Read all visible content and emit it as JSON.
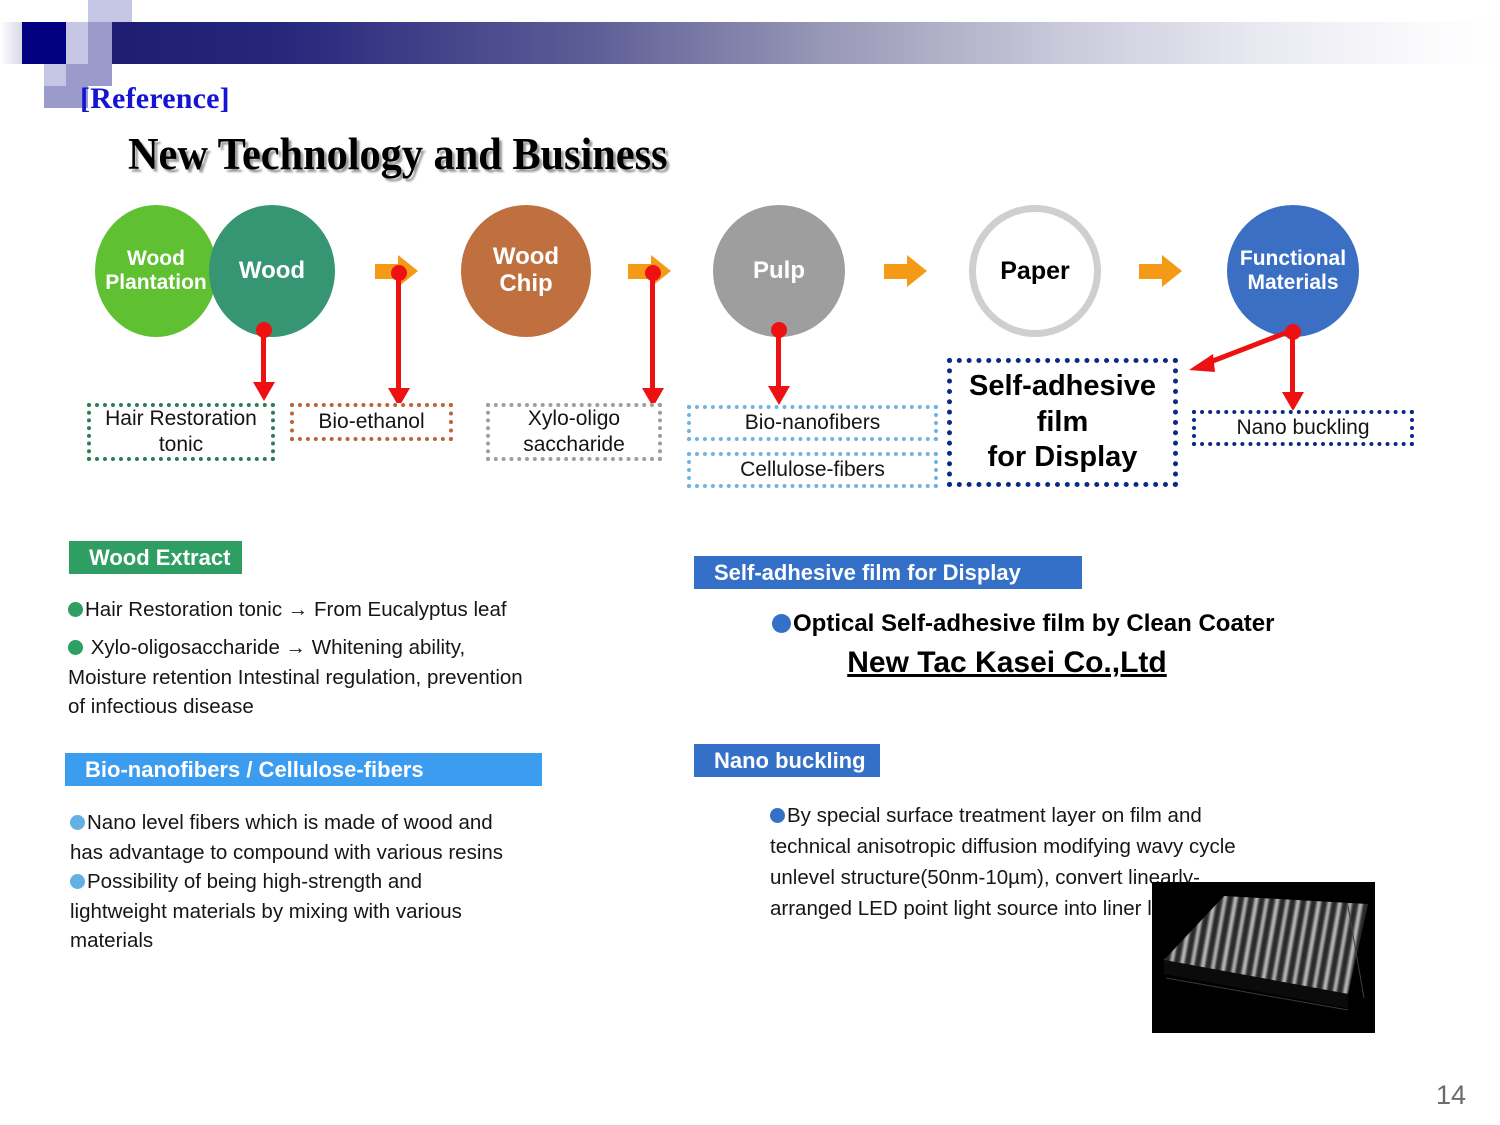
{
  "header": {
    "reference_label": "[Reference]",
    "title": "New Technology and Business"
  },
  "flow": {
    "nodes": [
      {
        "label": "Wood\nPlantation",
        "color": "#5fc132",
        "name": "wood-plantation"
      },
      {
        "label": "Wood",
        "color": "#369673",
        "name": "wood"
      },
      {
        "label": "Wood\nChip",
        "color": "#c0703f",
        "name": "wood-chip"
      },
      {
        "label": "Pulp",
        "color": "#9e9e9e",
        "name": "pulp"
      },
      {
        "label": "Paper",
        "color": "#ffffff",
        "name": "paper"
      },
      {
        "label": "Functional\nMaterials",
        "color": "#3b6fc4",
        "name": "functional-materials"
      }
    ],
    "arrow_icon": "right-arrow-icon",
    "boxes": [
      {
        "label": "Hair Restoration\ntonic",
        "name": "hair-restoration-tonic",
        "border": "#2f7d54"
      },
      {
        "label": "Bio-ethanol",
        "name": "bio-ethanol",
        "border": "#b9653a"
      },
      {
        "label": "Xylo-oligo\nsaccharide",
        "name": "xylo-oligo-saccharide",
        "border": "#9e9e9e"
      },
      {
        "label": "Bio-nanofibers",
        "name": "bio-nanofibers",
        "border": "#6fb4e6"
      },
      {
        "label": "Cellulose-fibers",
        "name": "cellulose-fibers",
        "border": "#6fb4e6"
      },
      {
        "label": "Self-adhesive\nfilm\nfor Display",
        "name": "self-adhesive-film-for-display",
        "border": "#0a2a87"
      },
      {
        "label": "Nano buckling",
        "name": "nano-buckling",
        "border": "#0a2a87"
      }
    ]
  },
  "sections": {
    "wood_extract": {
      "heading": "Wood Extract",
      "heading_color": "#2f9e63",
      "bullets": [
        "Hair Restoration tonic → From Eucalyptus leaf",
        " Xylo-oligosaccharide → Whitening ability, Moisture retention Intestinal regulation, prevention of infectious disease"
      ]
    },
    "self_adhesive": {
      "heading": "Self-adhesive film for Display",
      "heading_color": "#3570c8",
      "bullet": "Optical Self-adhesive film by Clean Coater",
      "company": "New Tac Kasei Co.,Ltd"
    },
    "bio_nanofibers": {
      "heading": "Bio-nanofibers / Cellulose-fibers",
      "heading_color": "#3c9cf0",
      "bullets": [
        "Nano level fibers which is made of wood and has advantage to compound with various resins",
        "Possibility of being high-strength and lightweight materials by mixing with various materials"
      ]
    },
    "nano_buckling": {
      "heading": "Nano buckling",
      "heading_color": "#3570c8",
      "bullet": "By special surface treatment layer on film and technical anisotropic diffusion modifying wavy cycle unlevel structure(50nm-10µm), convert linearly-arranged LED point light source into liner light source.",
      "image_caption": "nano-buckling-afm-surface"
    }
  },
  "footer": {
    "page_number": "14"
  },
  "colors": {
    "band_start": "#1d1d73",
    "band_end": "#ffffff",
    "reference_blue": "#1414d2",
    "orange_arrow": "#f59a17",
    "red_connector": "#ee1111"
  }
}
